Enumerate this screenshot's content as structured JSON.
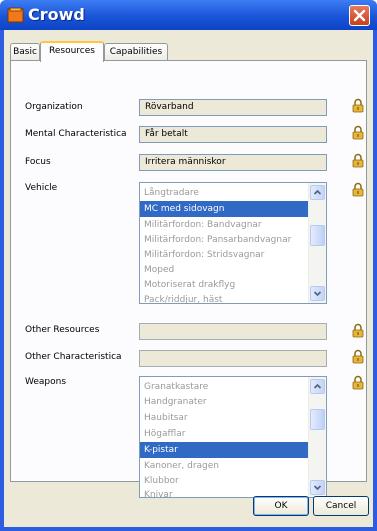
{
  "window": {
    "title": "Crowd"
  },
  "tabs": [
    {
      "label": "Basic",
      "active": false
    },
    {
      "label": "Resources",
      "active": true
    },
    {
      "label": "Capabilities",
      "active": false
    }
  ],
  "fields": {
    "organization": {
      "label": "Organization",
      "value": "Rövarband"
    },
    "mental": {
      "label": "Mental Characteristica",
      "value": "Får betalt"
    },
    "focus": {
      "label": "Focus",
      "value": "Irritera människor"
    },
    "vehicle": {
      "label": "Vehicle"
    },
    "other_resources": {
      "label": "Other Resources",
      "value": ""
    },
    "other_characteristica": {
      "label": "Other Characteristica",
      "value": ""
    },
    "weapons": {
      "label": "Weapons"
    }
  },
  "vehicle_items": [
    {
      "text": "Långtradare",
      "selected": false
    },
    {
      "text": "MC med sidovagn",
      "selected": true
    },
    {
      "text": "Militärfordon: Bandvagnar",
      "selected": false
    },
    {
      "text": "Militärfordon: Pansarbandvagnar",
      "selected": false
    },
    {
      "text": "Militärfordon: Stridsvagnar",
      "selected": false
    },
    {
      "text": "Moped",
      "selected": false
    },
    {
      "text": "Motoriserat drakflyg",
      "selected": false
    },
    {
      "text": "Pack/riddjur, häst",
      "selected": false
    }
  ],
  "weapon_items": [
    {
      "text": "Granatkastare",
      "selected": false
    },
    {
      "text": "Handgranater",
      "selected": false
    },
    {
      "text": "Haubitsar",
      "selected": false
    },
    {
      "text": "Högafflar",
      "selected": false
    },
    {
      "text": "K-pistar",
      "selected": true
    },
    {
      "text": "Kanoner, dragen",
      "selected": false
    },
    {
      "text": "Klubbor",
      "selected": false
    },
    {
      "text": "Knivar",
      "selected": false
    }
  ],
  "buttons": {
    "ok": "OK",
    "cancel": "Cancel"
  },
  "colors": {
    "titlebar": "#1a54d8",
    "selection": "#316ac5",
    "lock": "#e8b53a"
  }
}
